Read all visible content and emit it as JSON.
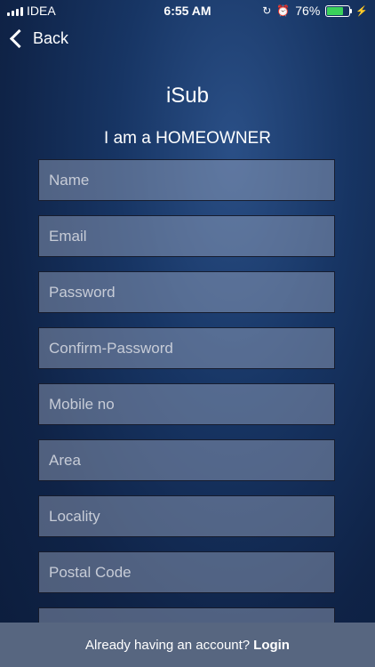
{
  "status_bar": {
    "carrier": "IDEA",
    "time": "6:55 AM",
    "battery_percent": "76%",
    "battery_level": 0.76,
    "battery_color": "#3ad25b",
    "icons": [
      "signal-icon",
      "lock-rotation-icon",
      "alarm-icon",
      "battery-icon",
      "charging-icon"
    ]
  },
  "nav": {
    "back_label": "Back"
  },
  "header": {
    "app_title": "iSub",
    "subtitle": "I am a HOMEOWNER"
  },
  "form": {
    "fields": [
      {
        "placeholder": "Name",
        "value": ""
      },
      {
        "placeholder": "Email",
        "value": ""
      },
      {
        "placeholder": "Password",
        "value": ""
      },
      {
        "placeholder": "Confirm-Password",
        "value": ""
      },
      {
        "placeholder": "Mobile no",
        "value": ""
      },
      {
        "placeholder": "Area",
        "value": ""
      },
      {
        "placeholder": "Locality",
        "value": ""
      },
      {
        "placeholder": "Postal Code",
        "value": ""
      }
    ]
  },
  "footer": {
    "prompt": "Already having an account?",
    "login_label": "Login",
    "background": "#576680"
  }
}
